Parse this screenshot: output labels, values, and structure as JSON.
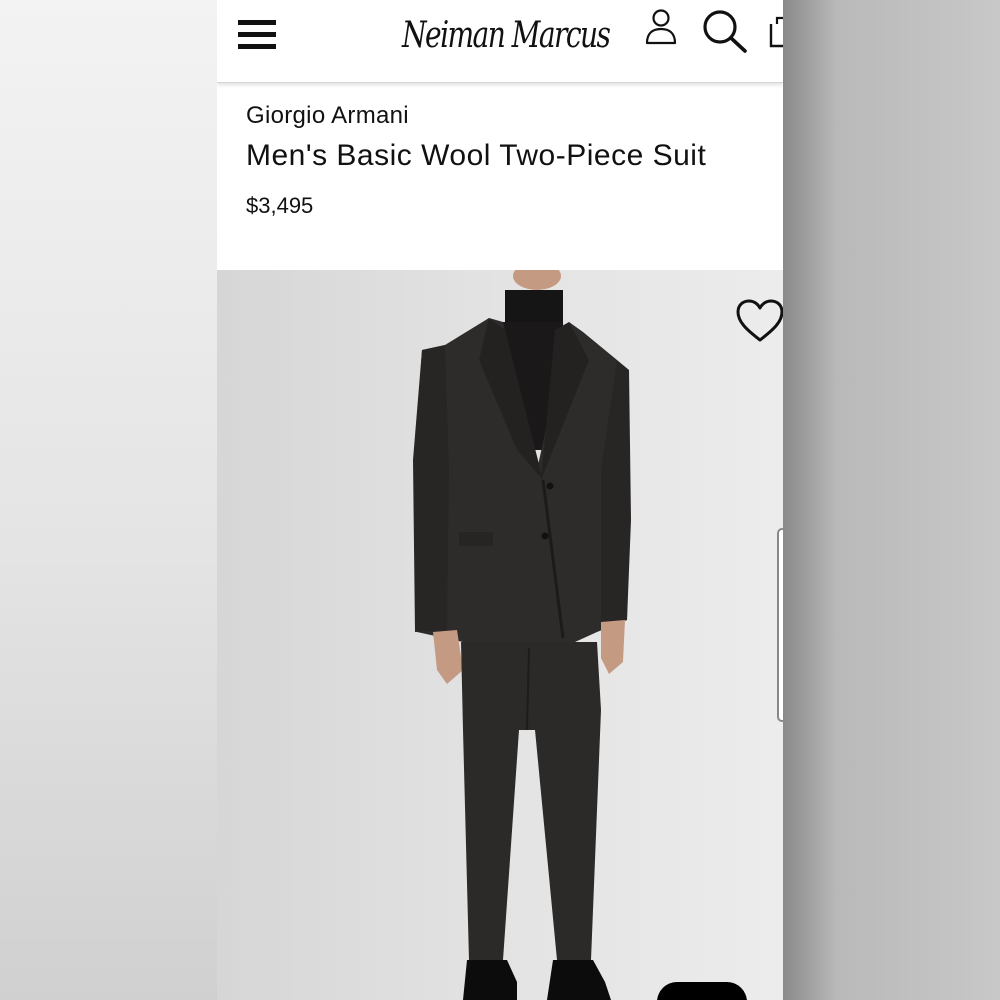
{
  "header": {
    "menu_icon": "hamburger-menu-icon",
    "logo_text": "Neiman Marcus",
    "account_icon": "user-icon",
    "search_icon": "search-icon",
    "bag_icon": "shopping-bag-icon"
  },
  "product": {
    "brand": "Giorgio Armani",
    "name": "Men's Basic Wool Two-Piece Suit",
    "price": "$3,495"
  },
  "image": {
    "favorite_icon": "heart-icon"
  },
  "colors": {
    "text": "#111111",
    "background": "#ffffff",
    "image_bg": "#e3e3e3",
    "suit": "#2b2a29"
  }
}
